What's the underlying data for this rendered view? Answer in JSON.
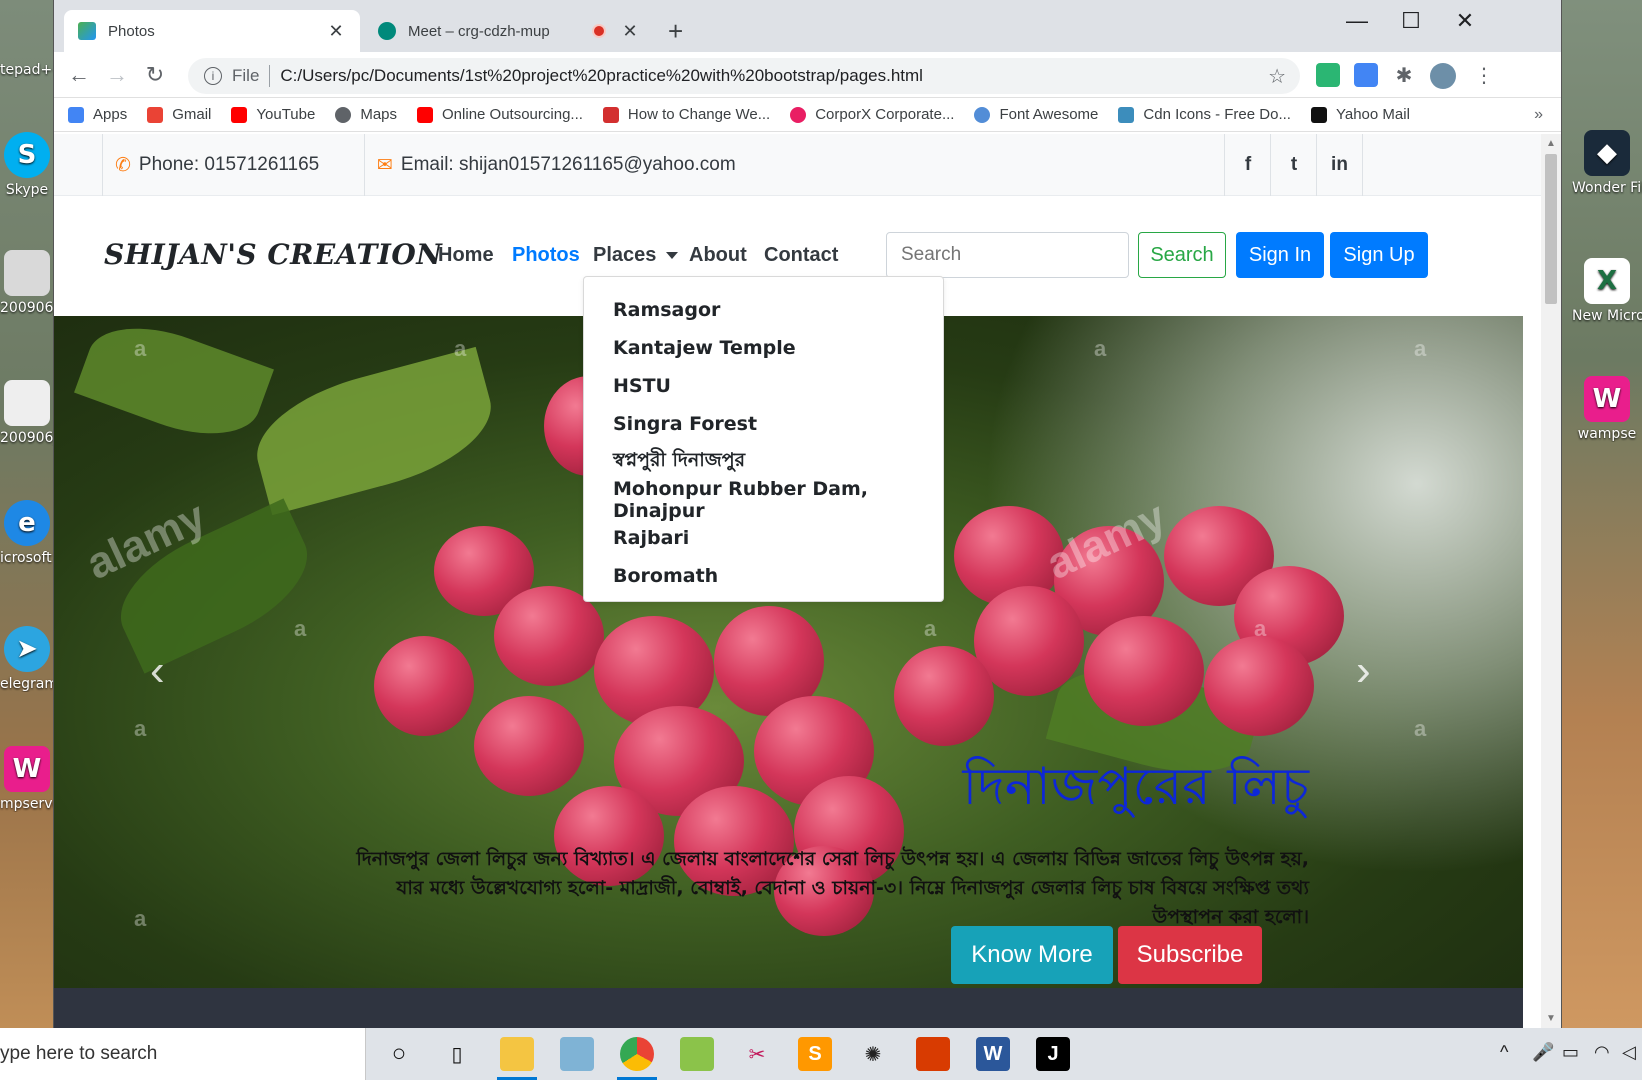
{
  "browser": {
    "tabs": [
      {
        "title": "Photos",
        "active": true
      },
      {
        "title": "Meet – crg-cdzh-mup",
        "active": false
      }
    ],
    "address": {
      "scheme_label": "File",
      "url": "C:/Users/pc/Documents/1st%20project%20practice%20with%20bootstrap/pages.html"
    },
    "bookmarks": [
      {
        "label": "Apps",
        "icon": "apps-grid-icon",
        "color": "#4285f4"
      },
      {
        "label": "Gmail",
        "icon": "gmail-icon",
        "color": "#ea4335"
      },
      {
        "label": "YouTube",
        "icon": "youtube-icon",
        "color": "#ff0000"
      },
      {
        "label": "Maps",
        "icon": "globe-icon",
        "color": "#5f6368"
      },
      {
        "label": "Online Outsourcing...",
        "icon": "youtube-icon",
        "color": "#ff0000"
      },
      {
        "label": "How to Change We...",
        "icon": "dt-icon",
        "color": "#d32f2f"
      },
      {
        "label": "CorporX Corporate...",
        "icon": "spiral-icon",
        "color": "#e91e63"
      },
      {
        "label": "Font Awesome",
        "icon": "font-awesome-icon",
        "color": "#528dd7"
      },
      {
        "label": "Cdn Icons - Free Do...",
        "icon": "image-icon",
        "color": "#3c8dbc"
      },
      {
        "label": "Yahoo Mail",
        "icon": "amazon-icon",
        "color": "#111111"
      }
    ]
  },
  "topbar": {
    "phone": "Phone: 01571261165",
    "email": "Email: shijan01571261165@yahoo.com",
    "social": [
      "facebook-icon",
      "twitter-icon",
      "linkedin-icon"
    ]
  },
  "navbar": {
    "brand": "SHIJAN'S CREATION",
    "links": {
      "home": "Home",
      "photos": "Photos",
      "places": "Places",
      "about": "About",
      "contact": "Contact"
    },
    "search_placeholder": "Search",
    "search_button": "Search",
    "signin": "Sign In",
    "signup": "Sign Up"
  },
  "dropdown": {
    "items": [
      "Ramsagor",
      "Kantajew Temple",
      "HSTU",
      "Singra Forest",
      "স্বপ্নপুরী দিনাজপুর",
      "Mohonpur Rubber Dam, Dinajpur",
      "Rajbari",
      "Boromath"
    ]
  },
  "hero": {
    "title": "দিনাজপুরের লিচু",
    "text": "দিনাজপুর জেলা লিচুর জন্য বিখ্যাত। এ জেলায় বাংলাদেশের সেরা লিচু উৎপন্ন হয়। এ জেলায় বিভিন্ন জাতের লিচু উৎপন্ন হয়, যার মধ্যে উল্লেখযোগ্য হলো- মাদ্রাজী, বোম্বাই, বেদানা ও চায়না-৩। নিম্নে দিনাজপুর জেলার লিচু চাষ বিষয়ে সংক্ষিপ্ত তথ্য উপস্থাপন করা হলো।",
    "know_more": "Know More",
    "subscribe": "Subscribe",
    "watermark": "alamy"
  },
  "desktop": {
    "icons_left": [
      "tepad++",
      "Skype",
      "200906_",
      "200906_",
      "icrosoft Edge",
      "elegram",
      "mpserve"
    ],
    "icons_right": [
      "Wonder Filmo",
      "New Microso",
      "wampse"
    ]
  },
  "taskbar": {
    "search_text": "ype here to search"
  },
  "colors": {
    "primary": "#007bff",
    "success": "#28a745",
    "info": "#17a2b8",
    "danger": "#dc3545",
    "accent": "#fd7e14"
  }
}
